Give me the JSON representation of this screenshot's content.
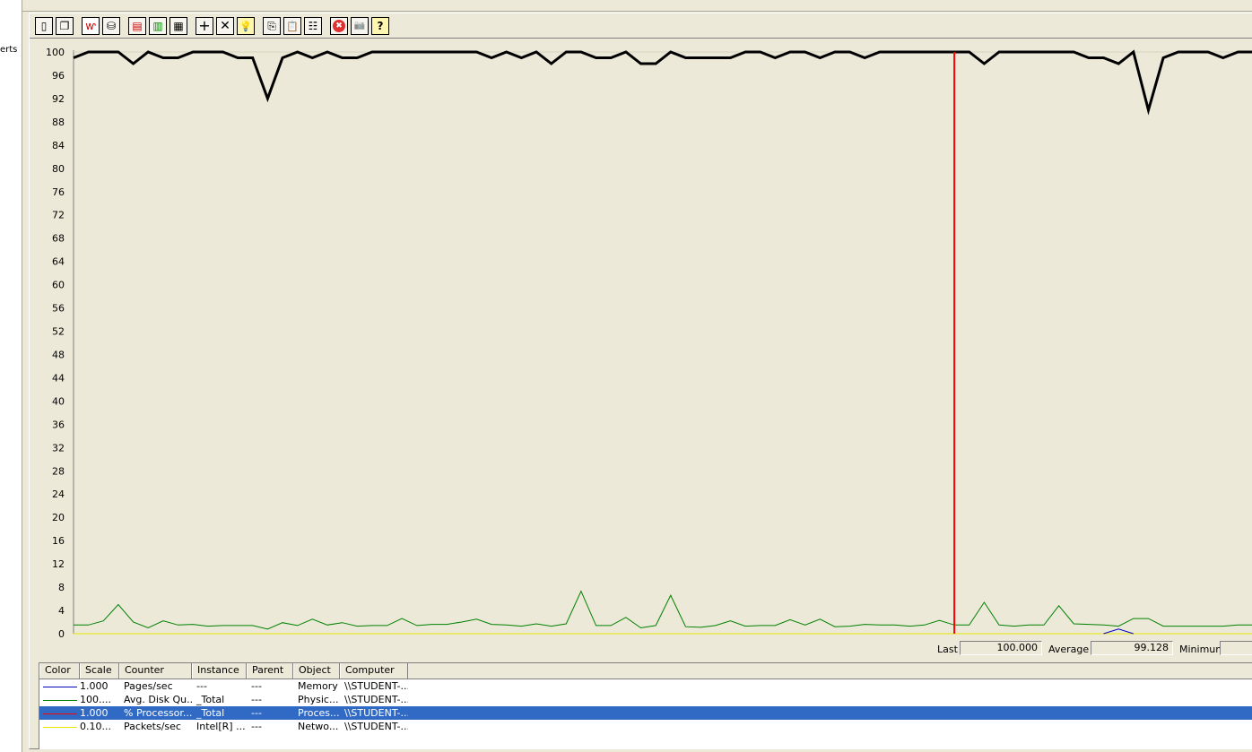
{
  "left_pane": {
    "partial_label": "erts"
  },
  "toolbar": {
    "buttons": [
      {
        "name": "new-counter-set-button",
        "glyph": "▯",
        "pressed": false
      },
      {
        "name": "clear-display-button",
        "glyph": "❐",
        "pressed": false
      },
      {
        "name": "view-current-activity-button",
        "glyph": "ⱳ",
        "pressed": true
      },
      {
        "name": "view-log-data-button",
        "glyph": "⛁",
        "pressed": false
      },
      {
        "name": "view-graph-button",
        "glyph": "▤",
        "pressed": false
      },
      {
        "name": "view-histogram-button",
        "glyph": "▥",
        "pressed": false
      },
      {
        "name": "view-report-button",
        "glyph": "▦",
        "pressed": false
      },
      {
        "name": "add-counter-button",
        "glyph": "+",
        "pressed": false
      },
      {
        "name": "delete-counter-button",
        "glyph": "✕",
        "pressed": false
      },
      {
        "name": "highlight-button",
        "glyph": "💡",
        "pressed": false
      },
      {
        "name": "copy-properties-button",
        "glyph": "⎘",
        "pressed": false
      },
      {
        "name": "paste-counter-list-button",
        "glyph": "📋",
        "pressed": false
      },
      {
        "name": "properties-button",
        "glyph": "☷",
        "pressed": false
      },
      {
        "name": "freeze-display-button",
        "glyph": "✖",
        "pressed": false
      },
      {
        "name": "update-data-button",
        "glyph": "📷",
        "pressed": false
      },
      {
        "name": "help-button",
        "glyph": "?",
        "pressed": false
      }
    ],
    "colors": {
      "freeze_red": "#e03030",
      "highlight_yellow": "#f7e000"
    }
  },
  "chart_data": {
    "type": "line",
    "ylim": [
      0,
      100
    ],
    "y_ticks": [
      "0",
      "4",
      "8",
      "12",
      "16",
      "20",
      "24",
      "28",
      "32",
      "36",
      "40",
      "44",
      "48",
      "52",
      "56",
      "60",
      "64",
      "68",
      "72",
      "76",
      "80",
      "84",
      "88",
      "92",
      "96",
      "100"
    ],
    "grid": false,
    "cursor_sample_index": 59,
    "series": [
      {
        "color": "#000000",
        "width": 3,
        "values": [
          99,
          100,
          100,
          100,
          98,
          100,
          99,
          99,
          100,
          100,
          100,
          99,
          99,
          92,
          99,
          100,
          99,
          100,
          99,
          99,
          100,
          100,
          100,
          100,
          100,
          100,
          100,
          100,
          99,
          100,
          99,
          100,
          98,
          100,
          100,
          99,
          99,
          100,
          98,
          98,
          100,
          99,
          99,
          99,
          99,
          100,
          100,
          99,
          100,
          100,
          99,
          100,
          100,
          99,
          100,
          100,
          100,
          100,
          100,
          100,
          100,
          98,
          100,
          100,
          100,
          100,
          100,
          100,
          99,
          99,
          98,
          100,
          90,
          99,
          100,
          100,
          100,
          99,
          100,
          100
        ]
      },
      {
        "color": "#008000",
        "width": 1,
        "values": [
          1.5,
          1.5,
          2.2,
          5,
          2,
          1,
          2.2,
          1.5,
          1.6,
          1.3,
          1.4,
          1.4,
          1.4,
          0.8,
          1.9,
          1.4,
          2.5,
          1.5,
          1.9,
          1.3,
          1.4,
          1.4,
          2.6,
          1.4,
          1.6,
          1.6,
          2,
          2.5,
          1.6,
          1.5,
          1.3,
          1.7,
          1.3,
          1.7,
          7.3,
          1.4,
          1.4,
          2.8,
          1,
          1.4,
          6.6,
          1.2,
          1.1,
          1.4,
          2.2,
          1.3,
          1.4,
          1.4,
          2.4,
          1.5,
          2.5,
          1.2,
          1.3,
          1.6,
          1.5,
          1.5,
          1.3,
          1.5,
          2.3,
          1.5,
          1.5,
          5.4,
          1.5,
          1.3,
          1.5,
          1.5,
          4.8,
          1.7,
          1.6,
          1.5,
          1.3,
          2.6,
          2.6,
          1.3,
          1.3,
          1.3,
          1.3,
          1.3,
          1.5,
          1.5
        ]
      },
      {
        "color": "#0000c0",
        "width": 1,
        "segment_start_index": 69,
        "values": [
          0,
          0.8,
          0
        ]
      },
      {
        "color": "#e8e800",
        "width": 1,
        "values": [
          0,
          0
        ]
      }
    ]
  },
  "stats": {
    "last_label": "Last",
    "last_value": "100.000",
    "average_label": "Average",
    "average_value": "99.128",
    "minimum_label": "Minimum"
  },
  "legend": {
    "headers": {
      "color": "Color",
      "scale": "Scale",
      "counter": "Counter",
      "instance": "Instance",
      "parent": "Parent",
      "object": "Object",
      "computer": "Computer"
    },
    "rows": [
      {
        "color": "#0000c0",
        "scale": "1.000",
        "counter": "Pages/sec",
        "instance": "---",
        "parent": "---",
        "object": "Memory",
        "computer": "\\\\STUDENT-...",
        "selected": false
      },
      {
        "color": "#008000",
        "scale": "100....",
        "counter": "Avg. Disk Qu...",
        "instance": "_Total",
        "parent": "---",
        "object": "Physic...",
        "computer": "\\\\STUDENT-...",
        "selected": false
      },
      {
        "color": "#ff0000",
        "scale": "1.000",
        "counter": "% Processor...",
        "instance": "_Total",
        "parent": "---",
        "object": "Proces...",
        "computer": "\\\\STUDENT-...",
        "selected": true
      },
      {
        "color": "#e8e800",
        "scale": "0.10...",
        "counter": "Packets/sec",
        "instance": "Intel[R] ...",
        "parent": "---",
        "object": "Netwo...",
        "computer": "\\\\STUDENT-...",
        "selected": false
      }
    ]
  }
}
